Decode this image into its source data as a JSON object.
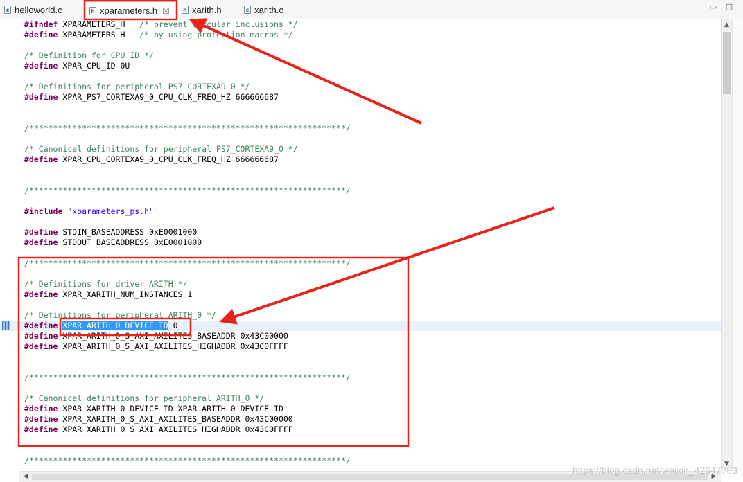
{
  "tabs": [
    {
      "label": "helloworld.c",
      "icon": "c-file-icon",
      "icon_glyph": "c"
    },
    {
      "label": "xparameters.h",
      "icon": "h-file-icon",
      "icon_glyph": "h",
      "active": true,
      "close": "☒"
    },
    {
      "label": "xarith.h",
      "icon": "h-file-icon",
      "icon_glyph": "h"
    },
    {
      "label": "xarith.c",
      "icon": "c-file-icon",
      "icon_glyph": "c"
    }
  ],
  "window_controls": {
    "minimize": "▭",
    "maximize": "□"
  },
  "code_lines": [
    [
      [
        "kw",
        "#ifndef"
      ],
      [
        "tx",
        " XPARAMETERS_H   "
      ],
      [
        "cm",
        "/* prevent circular inclusions */"
      ]
    ],
    [
      [
        "kw",
        "#define"
      ],
      [
        "tx",
        " XPARAMETERS_H   "
      ],
      [
        "cm",
        "/* by using protection macros */"
      ]
    ],
    [],
    [
      [
        "cm",
        "/* Definition for CPU ID */"
      ]
    ],
    [
      [
        "kw",
        "#define"
      ],
      [
        "tx",
        " XPAR_CPU_ID 0U"
      ]
    ],
    [],
    [
      [
        "cm",
        "/* Definitions for peripheral PS7_CORTEXA9_0 */"
      ]
    ],
    [
      [
        "kw",
        "#define"
      ],
      [
        "tx",
        " XPAR_PS7_CORTEXA9_0_CPU_CLK_FREQ_HZ 666666687"
      ]
    ],
    [],
    [],
    [
      [
        "cm",
        "/******************************************************************/"
      ]
    ],
    [],
    [
      [
        "cm",
        "/* Canonical definitions for peripheral PS7_CORTEXA9_0 */"
      ]
    ],
    [
      [
        "kw",
        "#define"
      ],
      [
        "tx",
        " XPAR_CPU_CORTEXA9_0_CPU_CLK_FREQ_HZ 666666687"
      ]
    ],
    [],
    [],
    [
      [
        "cm",
        "/******************************************************************/"
      ]
    ],
    [],
    [
      [
        "kw",
        "#include"
      ],
      [
        "tx",
        " "
      ],
      [
        "st",
        "\"xparameters_ps.h\""
      ]
    ],
    [],
    [
      [
        "kw",
        "#define"
      ],
      [
        "tx",
        " STDIN_BASEADDRESS 0xE0001000"
      ]
    ],
    [
      [
        "kw",
        "#define"
      ],
      [
        "tx",
        " STDOUT_BASEADDRESS 0xE0001000"
      ]
    ],
    [],
    [
      [
        "cm",
        "/******************************************************************/"
      ]
    ],
    [],
    [
      [
        "cm",
        "/* Definitions for driver ARITH */"
      ]
    ],
    [
      [
        "kw",
        "#define"
      ],
      [
        "tx",
        " XPAR_XARITH_NUM_INSTANCES 1"
      ]
    ],
    [],
    [
      [
        "cm",
        "/* Definitions for peripheral ARITH_0 */"
      ]
    ],
    [
      [
        "kw",
        "#define"
      ],
      [
        "tx",
        " "
      ],
      [
        "sel",
        "XPAR_ARITH_0_DEVICE_ID"
      ],
      [
        "tx",
        " 0"
      ]
    ],
    [
      [
        "kw",
        "#define"
      ],
      [
        "tx",
        " XPAR_ARITH_0_S_AXI_AXILITES_BASEADDR 0x43C00000"
      ]
    ],
    [
      [
        "kw",
        "#define"
      ],
      [
        "tx",
        " XPAR_ARITH_0_S_AXI_AXILITES_HIGHADDR 0x43C0FFFF"
      ]
    ],
    [],
    [],
    [
      [
        "cm",
        "/******************************************************************/"
      ]
    ],
    [],
    [
      [
        "cm",
        "/* Canonical definitions for peripheral ARITH_0 */"
      ]
    ],
    [
      [
        "kw",
        "#define"
      ],
      [
        "tx",
        " XPAR_XARITH_0_DEVICE_ID XPAR_ARITH_0_DEVICE_ID"
      ]
    ],
    [
      [
        "kw",
        "#define"
      ],
      [
        "tx",
        " XPAR_XARITH_0_S_AXI_AXILITES_BASEADDR 0x43C00000"
      ]
    ],
    [
      [
        "kw",
        "#define"
      ],
      [
        "tx",
        " XPAR_XARITH_0_S_AXI_AXILITES_HIGHADDR 0x43C0FFFF"
      ]
    ],
    [],
    [],
    [
      [
        "cm",
        "/******************************************************************/"
      ]
    ]
  ],
  "current_line_index": 29,
  "scroll": {
    "up": "▲",
    "down": "▼",
    "left": "◀",
    "right": "▶"
  },
  "watermark": "https://blog.csdn.net/weixin_42647783",
  "colors": {
    "keyword": "#7f0055",
    "comment": "#3f7f5f",
    "string": "#2a00ff",
    "selection": "#3399ff",
    "annotation": "#e8231a"
  }
}
